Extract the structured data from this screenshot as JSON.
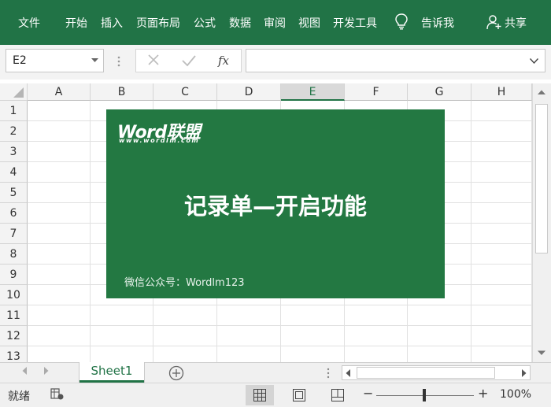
{
  "ribbon": {
    "tabs": [
      "文件",
      "开始",
      "插入",
      "页面布局",
      "公式",
      "数据",
      "审阅",
      "视图",
      "开发工具"
    ],
    "tell_me": "告诉我",
    "share": "共享"
  },
  "formula_bar": {
    "name_box": "E2",
    "fx_label": "fx",
    "formula_value": ""
  },
  "grid": {
    "columns": [
      "A",
      "B",
      "C",
      "D",
      "E",
      "F",
      "G",
      "H"
    ],
    "rows": [
      "1",
      "2",
      "3",
      "4",
      "5",
      "6",
      "7",
      "8",
      "9",
      "10",
      "11",
      "12",
      "13"
    ],
    "selected_column": "E"
  },
  "banner": {
    "logo_word": "Word联盟",
    "logo_url": "www.wordlm.com",
    "title": "记录单—开启功能",
    "wechat": "微信公众号：Wordlm123"
  },
  "sheet_tabs": {
    "active": "Sheet1"
  },
  "status_bar": {
    "ready": "就绪",
    "zoom": "100%",
    "zoom_minus": "−",
    "zoom_plus": "+"
  },
  "colors": {
    "ribbon": "#217346",
    "banner": "#237842"
  }
}
